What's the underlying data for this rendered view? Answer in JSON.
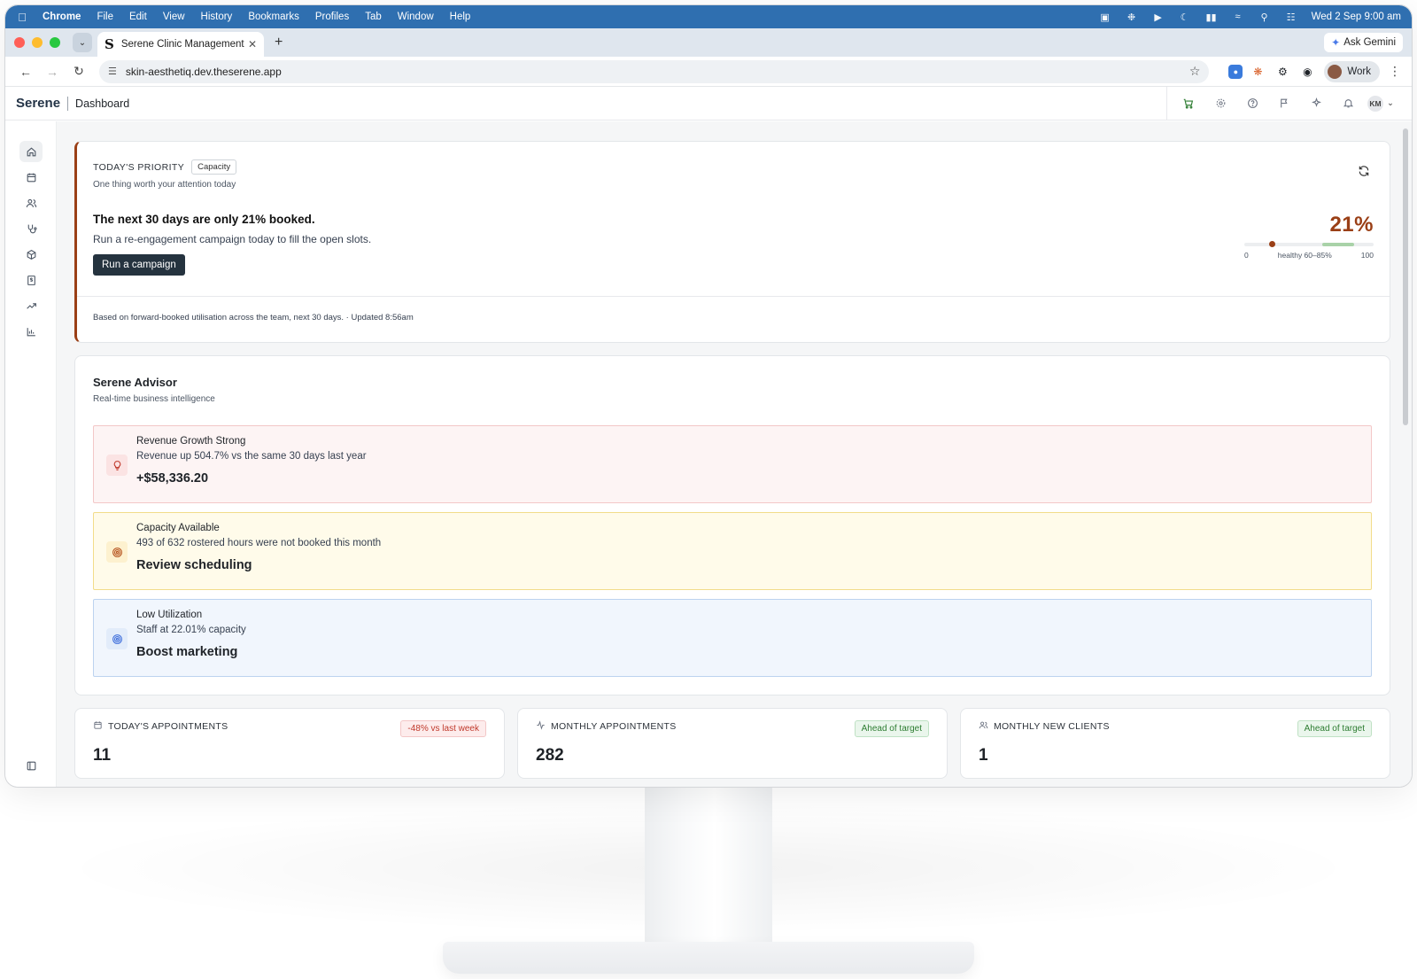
{
  "os": {
    "menu": [
      "Chrome",
      "File",
      "Edit",
      "View",
      "History",
      "Bookmarks",
      "Profiles",
      "Tab",
      "Window",
      "Help"
    ],
    "clock": "Wed 2 Sep  9:00 am"
  },
  "browser": {
    "tab_title": "Serene Clinic Management",
    "tab_favicon": "S",
    "ask_gemini": "Ask Gemini",
    "url": "skin-aesthetiq.dev.theserene.app",
    "profile": "Work"
  },
  "app": {
    "brand": "Serene",
    "breadcrumb": "Dashboard",
    "user_initials": "KM"
  },
  "priority": {
    "eyebrow": "TODAY'S PRIORITY",
    "tag": "Capacity",
    "subtitle": "One thing worth your attention today",
    "headline": "The next 30 days are only 21% booked.",
    "body": "Run a re-engagement campaign today to fill the open slots.",
    "cta": "Run a campaign",
    "gauge": {
      "value_label": "21%",
      "value": 21,
      "healthy_min": 60,
      "healthy_max": 85,
      "min_label": "0",
      "band_label": "healthy 60–85%",
      "max_label": "100"
    },
    "footnote": "Based on forward-booked utilisation across the team, next 30 days. · Updated 8:56am"
  },
  "advisor": {
    "title": "Serene Advisor",
    "subtitle": "Real-time business intelligence",
    "insights": [
      {
        "title": "Revenue Growth Strong",
        "detail": "Revenue up 504.7% vs the same 30 days last year",
        "value": "+$58,336.20",
        "tone": "red",
        "icon": "lightbulb-icon"
      },
      {
        "title": "Capacity Available",
        "detail": "493 of 632 rostered hours were not booked this month",
        "value": "Review scheduling",
        "tone": "yellow",
        "icon": "target-icon"
      },
      {
        "title": "Low Utilization",
        "detail": "Staff at 22.01% capacity",
        "value": "Boost marketing",
        "tone": "blue",
        "icon": "target-icon"
      }
    ]
  },
  "stats": [
    {
      "label": "TODAY'S APPOINTMENTS",
      "value": "11",
      "badge": "-48% vs last week",
      "badge_tone": "red",
      "icon": "calendar-icon"
    },
    {
      "label": "MONTHLY APPOINTMENTS",
      "value": "282",
      "badge": "Ahead of target",
      "badge_tone": "green",
      "icon": "activity-icon"
    },
    {
      "label": "MONTHLY NEW CLIENTS",
      "value": "1",
      "badge": "Ahead of target",
      "badge_tone": "green",
      "icon": "users-icon"
    }
  ]
}
